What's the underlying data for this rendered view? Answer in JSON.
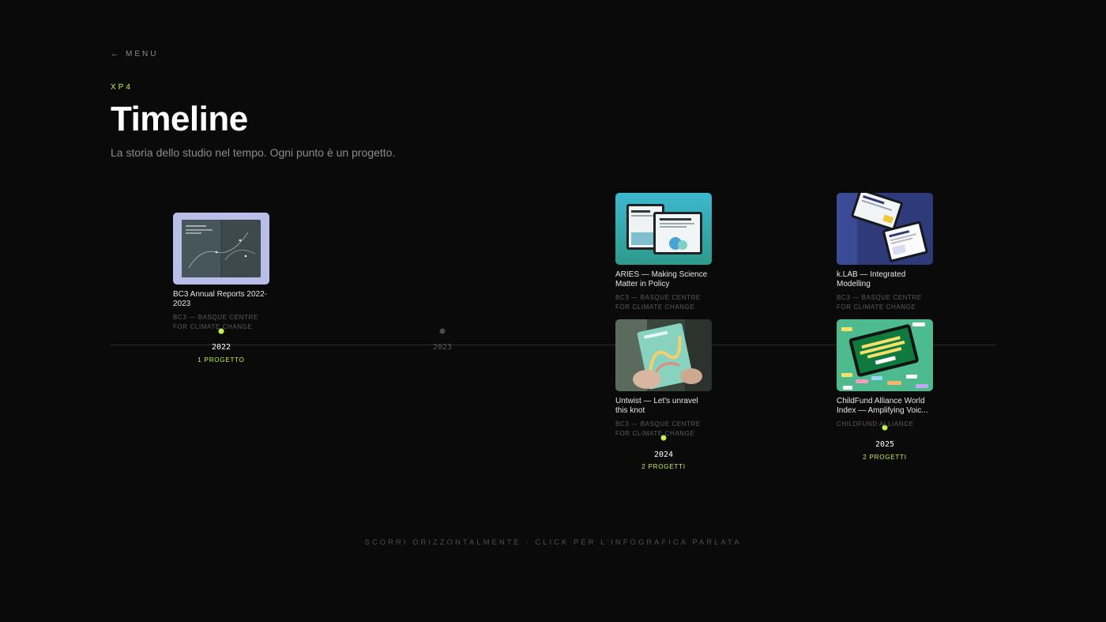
{
  "nav": {
    "back_label": "MENU"
  },
  "header": {
    "eyebrow": "XP4",
    "title": "Timeline",
    "subtitle": "La storia dello studio nel tempo. Ogni punto è un progetto."
  },
  "timeline": {
    "years": [
      {
        "year": "2022",
        "count_label": "1 PROGETTO"
      },
      {
        "year": "2023",
        "count_label": ""
      },
      {
        "year": "2024",
        "count_label": "2 PROGETTI"
      },
      {
        "year": "2025",
        "count_label": "2 PROGETTI"
      }
    ],
    "projects": [
      {
        "title": "BC3 Annual Reports 2022-2023",
        "client": "BC3 — BASQUE CENTRE FOR CLIMATE CHANGE"
      },
      {
        "title": "ARIES — Making Science Matter in Policy",
        "client": "BC3 — BASQUE CENTRE FOR CLIMATE CHANGE"
      },
      {
        "title": "Untwist — Let's unravel this knot",
        "client": "BC3 — BASQUE CENTRE FOR CLIMATE CHANGE"
      },
      {
        "title": "k.LAB — Integrated Modelling",
        "client": "BC3 — BASQUE CENTRE FOR CLIMATE CHANGE"
      },
      {
        "title": "ChildFund Alliance World Index — Amplifying Voic...",
        "client": "CHILDFUND ALLIANCE"
      }
    ]
  },
  "footer": {
    "hint": "SCORRI ORIZZONTALMENTE · CLICK PER L'INFOGRAFICA PARLATA"
  },
  "colors": {
    "accent": "#c8f24a",
    "background": "#0a0a0b"
  }
}
